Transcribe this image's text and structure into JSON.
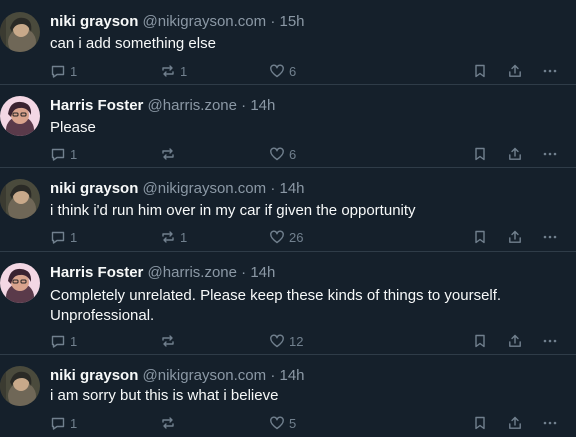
{
  "colors": {
    "background": "#15202b",
    "text": "#f7f9f9",
    "muted": "#8b98a5",
    "icon": "#71808e"
  },
  "posts": [
    {
      "author": "niki grayson",
      "handle": "@nikigrayson.com",
      "separator": "·",
      "time": "15h",
      "text": "can i add something else",
      "replies": "1",
      "reposts": "1",
      "likes": "6"
    },
    {
      "author": "Harris Foster",
      "handle": "@harris.zone",
      "separator": "·",
      "time": "14h",
      "text": "Please",
      "replies": "1",
      "reposts": "",
      "likes": "6"
    },
    {
      "author": "niki grayson",
      "handle": "@nikigrayson.com",
      "separator": "·",
      "time": "14h",
      "text": "i think i'd run him over in my car if given the opportunity",
      "replies": "1",
      "reposts": "1",
      "likes": "26"
    },
    {
      "author": "Harris Foster",
      "handle": "@harris.zone",
      "separator": "·",
      "time": "14h",
      "text": "Completely unrelated. Please keep these kinds of things to yourself. Unprofessional.",
      "replies": "1",
      "reposts": "",
      "likes": "12"
    },
    {
      "author": "niki grayson",
      "handle": "@nikigrayson.com",
      "separator": "·",
      "time": "14h",
      "text": "i am sorry but this is what i believe",
      "replies": "1",
      "reposts": "",
      "likes": "5"
    }
  ]
}
